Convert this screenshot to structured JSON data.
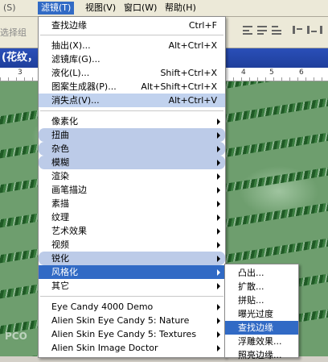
{
  "menubar": {
    "items": [
      {
        "label": "滤镜(T)",
        "active": true
      },
      {
        "label": "视图(V)",
        "active": false
      },
      {
        "label": "窗口(W)",
        "active": false
      },
      {
        "label": "帮助(H)",
        "active": false
      }
    ],
    "left_cut": "(S)"
  },
  "optionsbar": {
    "cut_label": "选择组"
  },
  "document": {
    "title_cut": "(花纹，"
  },
  "ruler": {
    "labels": [
      "3",
      "4",
      "5",
      "6"
    ]
  },
  "filter_menu": {
    "items": [
      {
        "label": "查找边缘",
        "shortcut": "Ctrl+F"
      },
      {
        "label": "抽出(X)...",
        "shortcut": "Alt+Ctrl+X"
      },
      {
        "label": "滤镜库(G)...",
        "shortcut": ""
      },
      {
        "label": "液化(L)...",
        "shortcut": "Shift+Ctrl+X"
      },
      {
        "label": "图案生成器(P)...",
        "shortcut": "Alt+Shift+Ctrl+X"
      },
      {
        "label": "消失点(V)...",
        "shortcut": "Alt+Ctrl+V"
      },
      {
        "label": "像素化"
      },
      {
        "label": "扭曲"
      },
      {
        "label": "杂色"
      },
      {
        "label": "模糊"
      },
      {
        "label": "渲染"
      },
      {
        "label": "画笔描边"
      },
      {
        "label": "素描"
      },
      {
        "label": "纹理"
      },
      {
        "label": "艺术效果"
      },
      {
        "label": "视频"
      },
      {
        "label": "锐化"
      },
      {
        "label": "风格化"
      },
      {
        "label": "其它"
      },
      {
        "label": "Eye Candy 4000 Demo"
      },
      {
        "label": "Alien Skin Eye Candy 5: Nature"
      },
      {
        "label": "Alien Skin Eye Candy 5: Textures"
      },
      {
        "label": "Alien Skin Image Doctor"
      }
    ]
  },
  "stylize_submenu": {
    "items": [
      {
        "label": "凸出..."
      },
      {
        "label": "扩散..."
      },
      {
        "label": "拼贴..."
      },
      {
        "label": "曝光过度"
      },
      {
        "label": "查找边缘"
      },
      {
        "label": "浮雕效果..."
      },
      {
        "label": "照亮边缘..."
      }
    ]
  },
  "watermark": "PCO",
  "colors": {
    "highlight": "#316ac5",
    "soft_highlight": "#c1d2ee",
    "title_bar": "#2a4fb8"
  }
}
